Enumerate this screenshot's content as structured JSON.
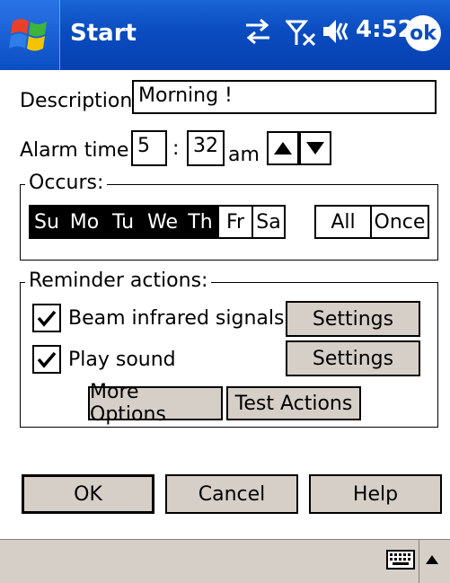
{
  "titlebar": {
    "title": "Start",
    "time": "4:52",
    "ok_label": "ok"
  },
  "description": {
    "label": "Description:",
    "value": "Morning !"
  },
  "alarm": {
    "label": "Alarm time:",
    "hour": "5",
    "separator": ":",
    "minute": "32",
    "ampm": "am"
  },
  "occurs": {
    "title": "Occurs:",
    "days": [
      "Su",
      "Mo",
      "Tu",
      "We",
      "Th",
      "Fr",
      "Sa"
    ],
    "all_label": "All",
    "once_label": "Once"
  },
  "reminder": {
    "title": "Reminder actions:",
    "beam_label": "Beam infrared signals",
    "sound_label": "Play sound",
    "settings_label": "Settings",
    "more_options_label": "More Options",
    "test_actions_label": "Test Actions"
  },
  "actions": {
    "ok_label": "OK",
    "cancel_label": "Cancel",
    "help_label": "Help"
  }
}
